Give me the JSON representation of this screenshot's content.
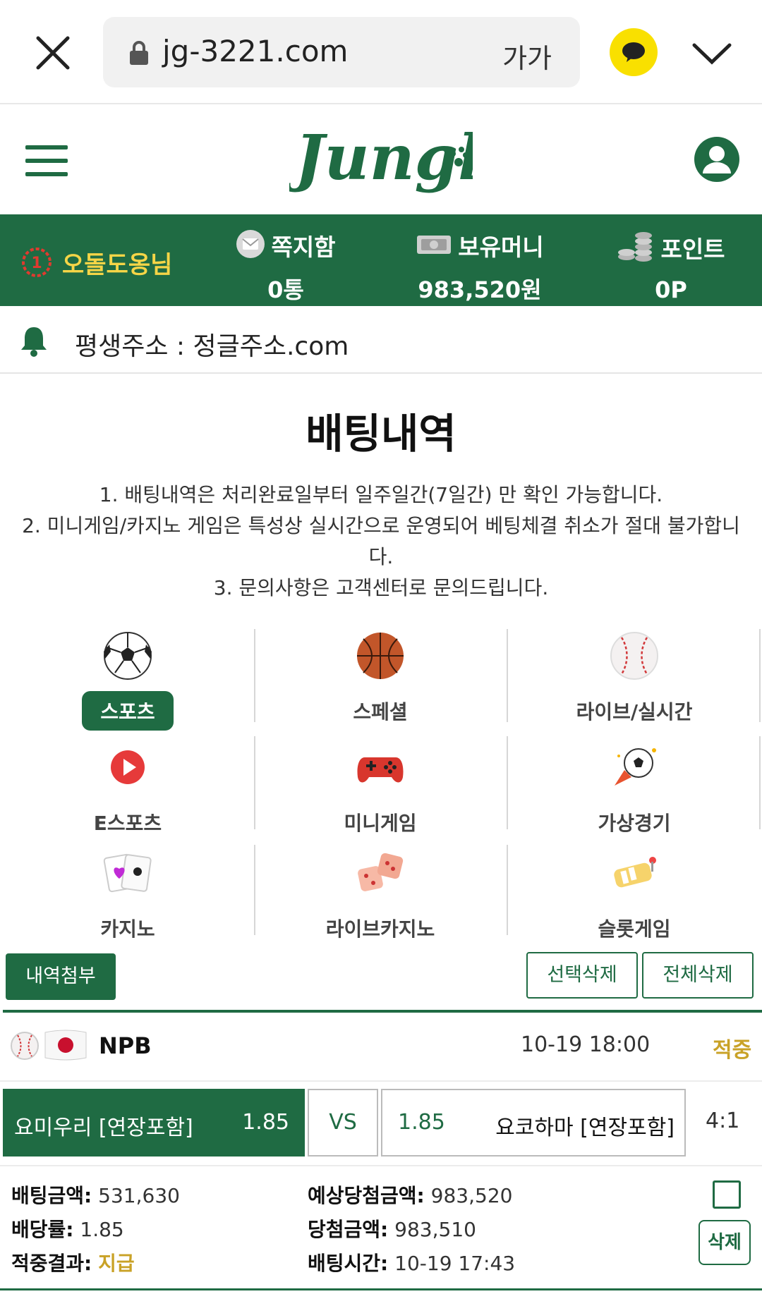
{
  "browser": {
    "url": "jg-3221.com",
    "text_size_label": "가가"
  },
  "header": {
    "logo_text": "Jungle"
  },
  "status": {
    "level_icon": "level-1-badge",
    "nickname": "오돌도옹님",
    "messages_label": "쪽지함",
    "messages_value": "0통",
    "money_label": "보유머니",
    "money_value": "983,520원",
    "points_label": "포인트",
    "points_value": "0P"
  },
  "notice": {
    "text": "평생주소 : 정글주소.com"
  },
  "page": {
    "title": "배팅내역",
    "rules": [
      "1. 배팅내역은 처리완료일부터 일주일간(7일간) 만 확인 가능합니다.",
      "2. 미니게임/카지노 게임은 특성상 실시간으로 운영되어 베팅체결 취소가 절대 불가합니다.",
      "3. 문의사항은 고객센터로 문의드립니다."
    ]
  },
  "categories": [
    {
      "label": "스포츠",
      "icon": "soccer-ball-icon",
      "active": true
    },
    {
      "label": "스페셜",
      "icon": "basketball-icon",
      "active": false
    },
    {
      "label": "라이브/실시간",
      "icon": "baseball-icon",
      "active": false
    },
    {
      "label": "E스포츠",
      "icon": "play-icon",
      "active": false
    },
    {
      "label": "미니게임",
      "icon": "gamepad-icon",
      "active": false
    },
    {
      "label": "가상경기",
      "icon": "soccer-rocket-icon",
      "active": false
    },
    {
      "label": "카지노",
      "icon": "cards-icon",
      "active": false
    },
    {
      "label": "라이브카지노",
      "icon": "dice-icon",
      "active": false
    },
    {
      "label": "슬롯게임",
      "icon": "slot-icon",
      "active": false
    }
  ],
  "actions": {
    "attach_label": "내역첨부",
    "delete_selected_label": "선택삭제",
    "delete_all_label": "전체삭제"
  },
  "bet": {
    "league": "NPB",
    "match_time": "10-19 18:00",
    "status": "적중",
    "home_team": "요미우리 [연장포함]",
    "home_odds": "1.85",
    "vs_label": "VS",
    "away_odds": "1.85",
    "away_team": "요코하마 [연장포함]",
    "score": "4:1",
    "amount_label": "배팅금액:",
    "amount_value": "531,630",
    "rate_label": "배당률:",
    "rate_value": "1.85",
    "result_label": "적중결과:",
    "result_value": "지급",
    "expected_label": "예상당첨금액:",
    "expected_value": "983,520",
    "won_label": "당첨금액:",
    "won_value": "983,510",
    "bet_time_label": "배팅시간:",
    "bet_time_value": "10-19 17:43",
    "delete_label": "삭제"
  },
  "colors": {
    "brand_green": "#1f6b43",
    "gold": "#c9a227",
    "nickname_yellow": "#f5d547",
    "kakao_yellow": "#f9e000"
  }
}
